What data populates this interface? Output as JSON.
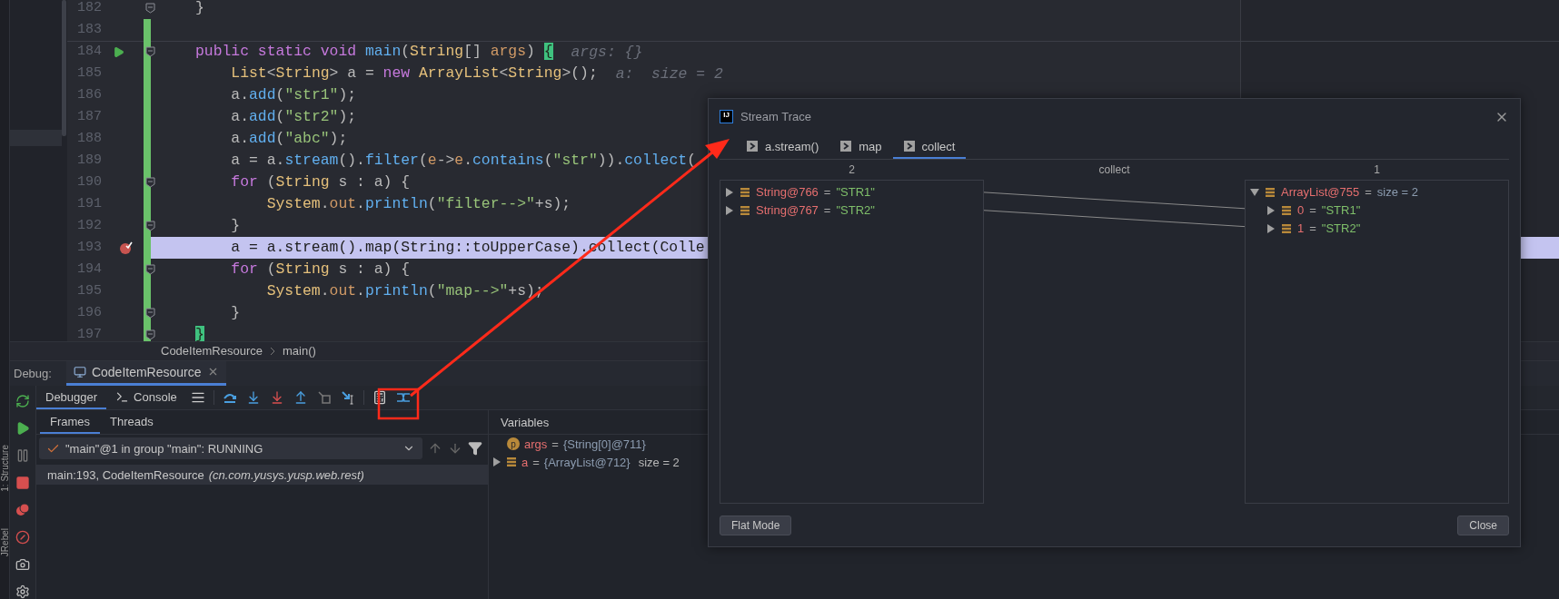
{
  "sidebar_labels": [
    "1: Structure",
    "JRebel"
  ],
  "editor": {
    "lines": [
      {
        "number": "182",
        "changed": false,
        "current": false,
        "fold": true,
        "segments": [
          {
            "kind": "plain",
            "text": "}"
          }
        ]
      },
      {
        "number": "183",
        "changed": true,
        "current": false,
        "fold": false
      },
      {
        "number": "184",
        "changed": true,
        "current": false,
        "fold": true,
        "separator": true,
        "runnable": true,
        "segments": [
          {
            "kind": "keyword",
            "text": "public static void "
          },
          {
            "kind": "method",
            "text": "main"
          },
          {
            "kind": "plain",
            "text": "("
          },
          {
            "kind": "type",
            "text": "String"
          },
          {
            "kind": "plain",
            "text": "[] "
          },
          {
            "kind": "param",
            "text": "args"
          },
          {
            "kind": "plain",
            "text": ") "
          },
          {
            "kind": "brace_match",
            "text": "{"
          }
        ],
        "hint": "args: {}"
      },
      {
        "number": "185",
        "changed": true,
        "current": false,
        "fold": false,
        "segments": [
          {
            "kind": "type",
            "text": "    List"
          },
          {
            "kind": "plain",
            "text": "<"
          },
          {
            "kind": "type",
            "text": "String"
          },
          {
            "kind": "plain",
            "text": "> a = "
          },
          {
            "kind": "keyword",
            "text": "new "
          },
          {
            "kind": "type",
            "text": "ArrayList"
          },
          {
            "kind": "plain",
            "text": "<"
          },
          {
            "kind": "type",
            "text": "String"
          },
          {
            "kind": "plain",
            "text": ">();"
          }
        ],
        "hint": "a:  size = 2"
      },
      {
        "number": "186",
        "changed": true,
        "current": false,
        "fold": false,
        "segments": [
          {
            "kind": "plain",
            "text": "    a."
          },
          {
            "kind": "method",
            "text": "add"
          },
          {
            "kind": "plain",
            "text": "("
          },
          {
            "kind": "string",
            "text": "\"str1\""
          },
          {
            "kind": "plain",
            "text": ");"
          }
        ]
      },
      {
        "number": "187",
        "changed": true,
        "current": false,
        "fold": false,
        "segments": [
          {
            "kind": "plain",
            "text": "    a."
          },
          {
            "kind": "method",
            "text": "add"
          },
          {
            "kind": "plain",
            "text": "("
          },
          {
            "kind": "string",
            "text": "\"str2\""
          },
          {
            "kind": "plain",
            "text": ");"
          }
        ]
      },
      {
        "number": "188",
        "changed": true,
        "current": false,
        "fold": false,
        "segments": [
          {
            "kind": "plain",
            "text": "    a."
          },
          {
            "kind": "method",
            "text": "add"
          },
          {
            "kind": "plain",
            "text": "("
          },
          {
            "kind": "string",
            "text": "\"abc\""
          },
          {
            "kind": "plain",
            "text": ");"
          }
        ]
      },
      {
        "number": "189",
        "changed": true,
        "current": false,
        "fold": false,
        "segments": [
          {
            "kind": "plain",
            "text": "    a = a."
          },
          {
            "kind": "method",
            "text": "stream"
          },
          {
            "kind": "plain",
            "text": "()."
          },
          {
            "kind": "method",
            "text": "filter"
          },
          {
            "kind": "plain",
            "text": "("
          },
          {
            "kind": "param",
            "text": "e"
          },
          {
            "kind": "plain",
            "text": "->"
          },
          {
            "kind": "param",
            "text": "e"
          },
          {
            "kind": "plain",
            "text": "."
          },
          {
            "kind": "method",
            "text": "contains"
          },
          {
            "kind": "plain",
            "text": "("
          },
          {
            "kind": "string",
            "text": "\"str\""
          },
          {
            "kind": "plain",
            "text": "))."
          },
          {
            "kind": "method",
            "text": "collect"
          },
          {
            "kind": "plain",
            "text": "("
          }
        ]
      },
      {
        "number": "190",
        "changed": true,
        "current": false,
        "fold": true,
        "segments": [
          {
            "kind": "keyword",
            "text": "    for"
          },
          {
            "kind": "plain",
            "text": " ("
          },
          {
            "kind": "type",
            "text": "String"
          },
          {
            "kind": "plain",
            "text": " s : a) {"
          }
        ]
      },
      {
        "number": "191",
        "changed": true,
        "current": false,
        "fold": false,
        "segments": [
          {
            "kind": "type",
            "text": "        System"
          },
          {
            "kind": "plain",
            "text": "."
          },
          {
            "kind": "field",
            "text": "out"
          },
          {
            "kind": "plain",
            "text": "."
          },
          {
            "kind": "method",
            "text": "println"
          },
          {
            "kind": "plain",
            "text": "("
          },
          {
            "kind": "string",
            "text": "\"filter-->\""
          },
          {
            "kind": "plain",
            "text": "+s);"
          }
        ]
      },
      {
        "number": "192",
        "changed": true,
        "current": false,
        "fold": true,
        "segments": [
          {
            "kind": "plain",
            "text": "    }"
          }
        ]
      },
      {
        "number": "193",
        "changed": true,
        "current": true,
        "fold": false,
        "breakpoint": true,
        "segments": [
          {
            "kind": "plain",
            "text": "    a = a.stream().map(String::toUpperCase).collect(Colle"
          }
        ]
      },
      {
        "number": "194",
        "changed": true,
        "current": false,
        "fold": true,
        "segments": [
          {
            "kind": "keyword",
            "text": "    for"
          },
          {
            "kind": "plain",
            "text": " ("
          },
          {
            "kind": "type",
            "text": "String"
          },
          {
            "kind": "plain",
            "text": " s : a) {"
          }
        ]
      },
      {
        "number": "195",
        "changed": true,
        "current": false,
        "fold": false,
        "segments": [
          {
            "kind": "type",
            "text": "        System"
          },
          {
            "kind": "plain",
            "text": "."
          },
          {
            "kind": "field",
            "text": "out"
          },
          {
            "kind": "plain",
            "text": "."
          },
          {
            "kind": "method",
            "text": "println"
          },
          {
            "kind": "plain",
            "text": "("
          },
          {
            "kind": "string",
            "text": "\"map-->\""
          },
          {
            "kind": "plain",
            "text": "+s);"
          }
        ]
      },
      {
        "number": "196",
        "changed": true,
        "current": false,
        "fold": true,
        "segments": [
          {
            "kind": "plain",
            "text": "    }"
          }
        ]
      },
      {
        "number": "197",
        "changed": true,
        "current": false,
        "fold": true,
        "segments": [
          {
            "kind": "brace_match",
            "text": "}"
          }
        ]
      }
    ]
  },
  "breadcrumb": [
    "CodeItemResource",
    "main()"
  ],
  "debug": {
    "label": "Debug:",
    "session_tab": "CodeItemResource",
    "subtabs": [
      {
        "label": "Debugger",
        "selected": true
      },
      {
        "label": "Console",
        "selected": false
      }
    ],
    "frame_tabs": [
      {
        "label": "Frames",
        "selected": true
      },
      {
        "label": "Threads",
        "selected": false
      }
    ],
    "thread": "\"main\"@1 in group \"main\": RUNNING",
    "frames": [
      {
        "location": "main:193, CodeItemResource",
        "package": "(cn.com.yusys.yusp.web.rest)",
        "selected": true
      }
    ],
    "variables_title": "Variables",
    "variables": [
      {
        "kind": "parameter",
        "badge": "p",
        "expandable": false,
        "name": "args",
        "sep": "=",
        "value": "{String[0]@711}"
      },
      {
        "kind": "field",
        "expandable": true,
        "name": "a",
        "sep": "=",
        "value": "{ArrayList@712}",
        "extra": "size = 2"
      }
    ]
  },
  "dialog": {
    "logo": "IJ",
    "title": "Stream Trace",
    "tabs": [
      {
        "label": "a.stream()",
        "selected": false
      },
      {
        "label": "map",
        "selected": false
      },
      {
        "label": "collect",
        "selected": true
      }
    ],
    "left_header": "2",
    "middle_header": "collect",
    "right_header": "1",
    "left_items": [
      {
        "name": "String@766",
        "sep": "=",
        "value": "\"STR1\"",
        "expanded": false
      },
      {
        "name": "String@767",
        "sep": "=",
        "value": "\"STR2\"",
        "expanded": false
      }
    ],
    "right_items": [
      {
        "name": "ArrayList@755",
        "sep": "=",
        "value": "size = 2",
        "expanded": true,
        "children": [
          {
            "name": "0",
            "sep": "=",
            "value": "\"STR1\"",
            "expanded": false
          },
          {
            "name": "1",
            "sep": "=",
            "value": "\"STR2\"",
            "expanded": false
          }
        ]
      }
    ],
    "buttons": [
      "Flat Mode",
      "Close"
    ]
  }
}
